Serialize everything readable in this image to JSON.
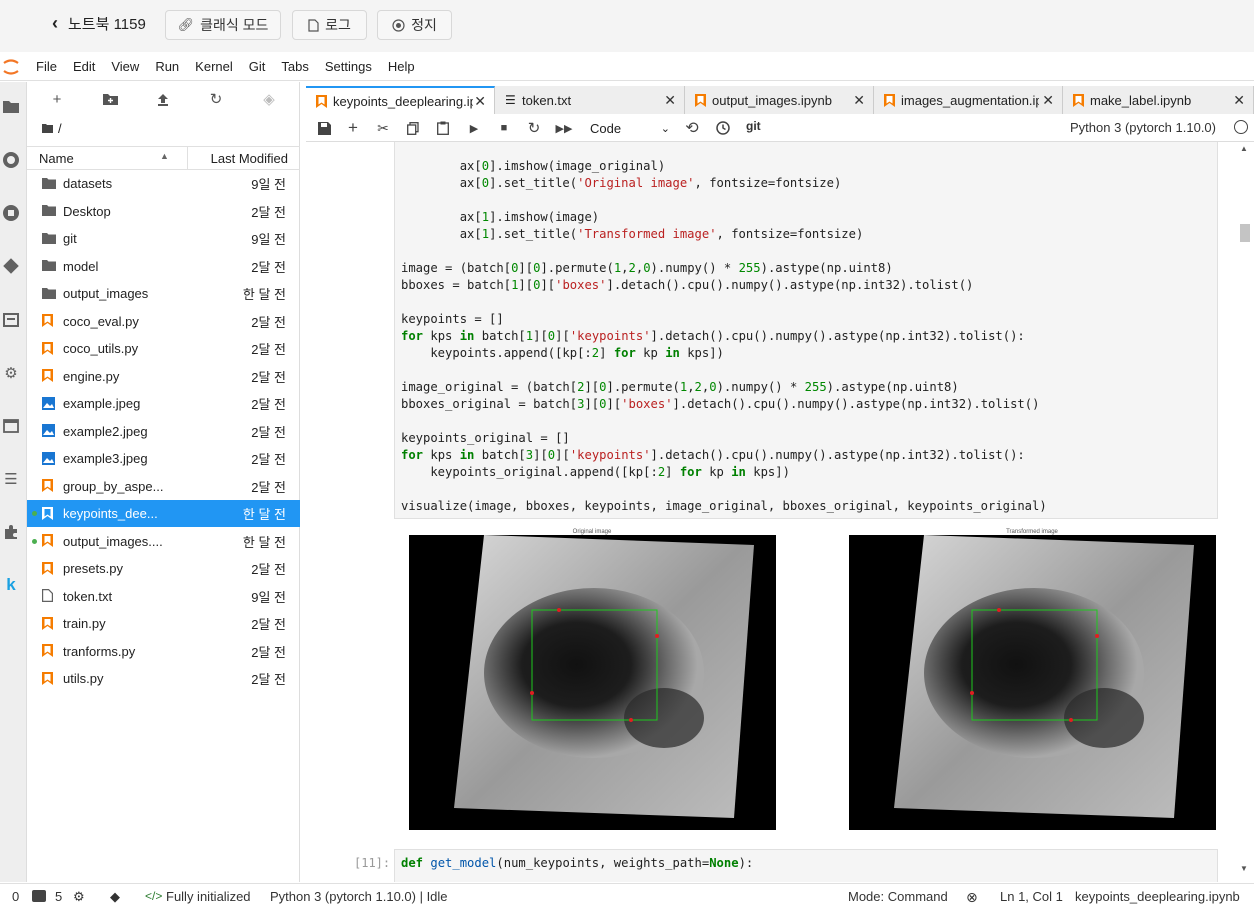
{
  "header": {
    "back_label": "노트북 1159",
    "classic_label": "클래식 모드",
    "log_label": "로그",
    "stop_label": "정지"
  },
  "menu": [
    "File",
    "Edit",
    "View",
    "Run",
    "Kernel",
    "Git",
    "Tabs",
    "Settings",
    "Help"
  ],
  "filebrowser": {
    "path": "/",
    "col_name": "Name",
    "col_modified": "Last Modified",
    "files": [
      {
        "name": "datasets",
        "date": "9일 전",
        "type": "folder"
      },
      {
        "name": "Desktop",
        "date": "2달 전",
        "type": "folder"
      },
      {
        "name": "git",
        "date": "9일 전",
        "type": "folder"
      },
      {
        "name": "model",
        "date": "2달 전",
        "type": "folder"
      },
      {
        "name": "output_images",
        "date": "한 달 전",
        "type": "folder"
      },
      {
        "name": "coco_eval.py",
        "date": "2달 전",
        "type": "py"
      },
      {
        "name": "coco_utils.py",
        "date": "2달 전",
        "type": "py"
      },
      {
        "name": "engine.py",
        "date": "2달 전",
        "type": "py"
      },
      {
        "name": "example.jpeg",
        "date": "2달 전",
        "type": "img"
      },
      {
        "name": "example2.jpeg",
        "date": "2달 전",
        "type": "img"
      },
      {
        "name": "example3.jpeg",
        "date": "2달 전",
        "type": "img"
      },
      {
        "name": "group_by_aspe...",
        "date": "2달 전",
        "type": "py"
      },
      {
        "name": "keypoints_dee...",
        "date": "한 달 전",
        "type": "nb"
      },
      {
        "name": "output_images....",
        "date": "한 달 전",
        "type": "nb"
      },
      {
        "name": "presets.py",
        "date": "2달 전",
        "type": "py"
      },
      {
        "name": "token.txt",
        "date": "9일 전",
        "type": "txt"
      },
      {
        "name": "train.py",
        "date": "2달 전",
        "type": "py"
      },
      {
        "name": "tranforms.py",
        "date": "2달 전",
        "type": "py"
      },
      {
        "name": "utils.py",
        "date": "2달 전",
        "type": "py"
      }
    ]
  },
  "tabs": [
    "keypoints_deeplearing.ipynb",
    "token.txt",
    "output_images.ipynb",
    "images_augmentation.ipynb",
    "make_label.ipynb"
  ],
  "toolbar": {
    "cell_type": "Code",
    "git_label": "git",
    "kernel": "Python 3 (pytorch 1.10.0)"
  },
  "code": {
    "lines": [
      "        ax[0].imshow(image_original)",
      "        ax[0].set_title('Original image', fontsize=fontsize)",
      "",
      "        ax[1].imshow(image)",
      "        ax[1].set_title('Transformed image', fontsize=fontsize)",
      "",
      "image = (batch[0][0].permute(1,2,0).numpy() * 255).astype(np.uint8)",
      "bboxes = batch[1][0]['boxes'].detach().cpu().numpy().astype(np.int32).tolist()",
      "",
      "keypoints = []",
      "for kps in batch[1][0]['keypoints'].detach().cpu().numpy().astype(np.int32).tolist():",
      "    keypoints.append([kp[:2] for kp in kps])",
      "",
      "image_original = (batch[2][0].permute(1,2,0).numpy() * 255).astype(np.uint8)",
      "bboxes_original = batch[3][0]['boxes'].detach().cpu().numpy().astype(np.int32).tolist()",
      "",
      "keypoints_original = []",
      "for kps in batch[3][0]['keypoints'].detach().cpu().numpy().astype(np.int32).tolist():",
      "    keypoints_original.append([kp[:2] for kp in kps])",
      "",
      "visualize(image, bboxes, keypoints, image_original, bboxes_original, keypoints_original)"
    ],
    "next_prompt": "[11]:",
    "next_line": "def get_model(num_keypoints, weights_path=None):"
  },
  "figure": {
    "left_title": "Original image",
    "right_title": "Transformed image"
  },
  "status": {
    "num1": "0",
    "num2": "5",
    "init": "Fully initialized",
    "kernel": "Python 3 (pytorch 1.10.0) | Idle",
    "mode": "Mode: Command",
    "pos": "Ln 1, Col 1",
    "file": "keypoints_deeplearing.ipynb"
  },
  "colors": {
    "accent": "#2196f3",
    "py_icon": "#f57c00",
    "img_icon": "#1976d2"
  }
}
